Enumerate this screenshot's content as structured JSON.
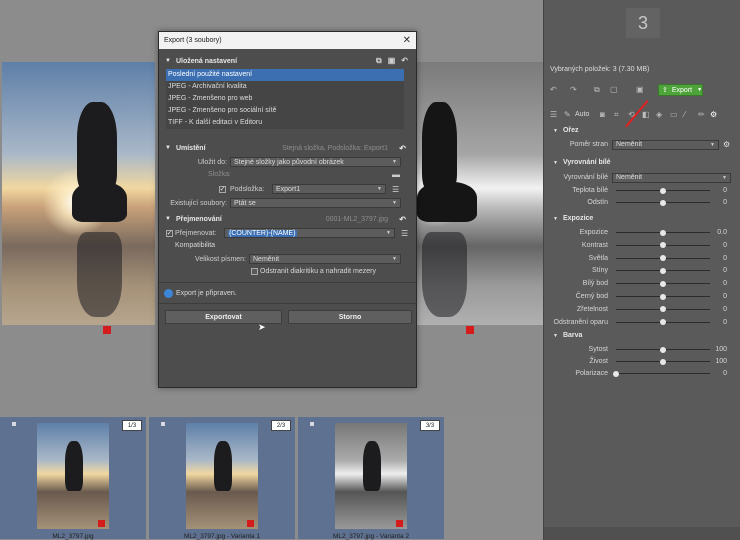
{
  "dialog": {
    "title": "Export (3 soubory)",
    "saved": {
      "heading": "Uložená nastavení",
      "items": [
        "Poslední použité nastavení",
        "JPEG - Archivační kvalita",
        "JPEG - Zmenšeno pro web",
        "JPEG - Zmenšeno pro sociální sítě",
        "TIFF - K další editaci v Editoru"
      ]
    },
    "location": {
      "heading": "Umístění",
      "summary": "Stejná složka, Podsložka: Export1",
      "save_to_label": "Uložit do:",
      "save_to_value": "Stejné složky jako původní obrázek",
      "folder_label": "Složka:",
      "subfolder_label": "Podsložka:",
      "subfolder_value": "Export1",
      "existing_label": "Existující soubory:",
      "existing_value": "Ptát se"
    },
    "rename": {
      "heading": "Přejmenování",
      "summary": "0001-ML2_3797.jpg",
      "rename_label": "Přejmenovat:",
      "rename_value": "{COUNTER}-{NAME}",
      "compat_label": "Kompatibilita",
      "case_label": "Velikost písmen:",
      "case_value": "Neměnit",
      "diacritics_label": "Odstranit diakritiku a nahradit mezery"
    },
    "status": "Export je připraven.",
    "export_button": "Exportovat",
    "cancel_button": "Storno"
  },
  "panel": {
    "count": "3",
    "selected": "Vybraných položek: 3 (7.30 MB)",
    "export_label": "Export",
    "auto_label": "Auto",
    "crop": {
      "heading": "Ořez",
      "ratio_label": "Poměr stran",
      "ratio_value": "Neměnit"
    },
    "wb": {
      "heading": "Vyrovnání bílé",
      "wb_label": "Vyrovnání bílé",
      "wb_value": "Neměnit",
      "sliders": [
        {
          "label": "Teplota bílé",
          "value": "0",
          "pos": 0.5
        },
        {
          "label": "Odstín",
          "value": "0",
          "pos": 0.5
        }
      ]
    },
    "exposure": {
      "heading": "Expozice",
      "sliders": [
        {
          "label": "Expozice",
          "value": "0.0",
          "pos": 0.5
        },
        {
          "label": "Kontrast",
          "value": "0",
          "pos": 0.5
        },
        {
          "label": "Světla",
          "value": "0",
          "pos": 0.5
        },
        {
          "label": "Stíny",
          "value": "0",
          "pos": 0.5
        },
        {
          "label": "Bílý bod",
          "value": "0",
          "pos": 0.5
        },
        {
          "label": "Černý bod",
          "value": "0",
          "pos": 0.5
        },
        {
          "label": "Zřetelnost",
          "value": "0",
          "pos": 0.5
        },
        {
          "label": "Odstranění oparu",
          "value": "0",
          "pos": 0.5
        }
      ]
    },
    "color": {
      "heading": "Barva",
      "sliders": [
        {
          "label": "Sytost",
          "value": "100",
          "pos": 0.5
        },
        {
          "label": "Živost",
          "value": "100",
          "pos": 0.5
        },
        {
          "label": "Polarizace",
          "value": "0",
          "pos": 0.0
        }
      ]
    }
  },
  "filmstrip": [
    {
      "name": "ML2_3797.jpg",
      "badge": "1/3",
      "bw": false
    },
    {
      "name": "ML2_3797.jpg - Varianta 1",
      "badge": "2/3",
      "bw": false
    },
    {
      "name": "ML2_3797.jpg - Varianta 2",
      "badge": "3/3",
      "bw": true
    }
  ],
  "colors": {
    "accent": "#3b6fb2",
    "export_green": "#4ea33a",
    "marker_red": "#d41c1c"
  }
}
